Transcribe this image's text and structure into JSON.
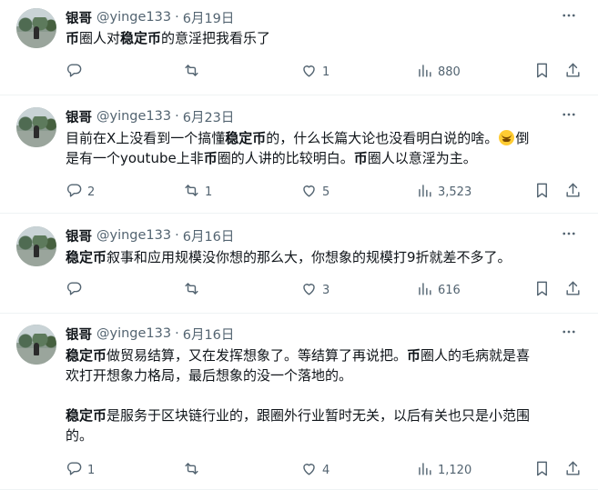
{
  "author": {
    "name": "银哥",
    "handle": "@yinge133",
    "separator": "·"
  },
  "tweets": [
    {
      "date": "6月19日",
      "lines": [
        [
          {
            "t": "币",
            "b": true
          },
          {
            "t": "圈人对",
            "b": false
          },
          {
            "t": "稳定币",
            "b": true
          },
          {
            "t": "的意淫把我看乐了",
            "b": false
          }
        ]
      ],
      "stats": {
        "replies": "",
        "retweets": "",
        "likes": "1",
        "views": "880"
      }
    },
    {
      "date": "6月23日",
      "lines": [
        [
          {
            "t": "目前在X上没看到一个搞懂",
            "b": false
          },
          {
            "t": "稳定币",
            "b": true
          },
          {
            "t": "的，什么长篇大论也没看明白说的啥。",
            "b": false
          },
          {
            "emoji": "grinning-sweat-emoji"
          },
          {
            "t": "倒",
            "b": false
          }
        ],
        [
          {
            "t": "是有一个youtube上非",
            "b": false
          },
          {
            "t": "币",
            "b": true
          },
          {
            "t": "圈的人讲的比较明白。",
            "b": false
          },
          {
            "t": "币",
            "b": true
          },
          {
            "t": "圈人以意淫为主。",
            "b": false
          }
        ]
      ],
      "stats": {
        "replies": "2",
        "retweets": "1",
        "likes": "5",
        "views": "3,523"
      }
    },
    {
      "date": "6月16日",
      "lines": [
        [
          {
            "t": "稳定币",
            "b": true
          },
          {
            "t": "叙事和应用规模没你想的那么大，你想象的规模打9折就差不多了。",
            "b": false
          }
        ]
      ],
      "stats": {
        "replies": "",
        "retweets": "",
        "likes": "3",
        "views": "616"
      }
    },
    {
      "date": "6月16日",
      "lines": [
        [
          {
            "t": "稳定币",
            "b": true
          },
          {
            "t": "做贸易结算，又在发挥想象了。等结算了再说把。",
            "b": false
          },
          {
            "t": "币",
            "b": true
          },
          {
            "t": "圈人的毛病就是喜",
            "b": false
          }
        ],
        [
          {
            "t": "欢打开想象力格局，最后想象的没一个落地的。",
            "b": false
          }
        ],
        [],
        [
          {
            "t": "稳定币",
            "b": true
          },
          {
            "t": "是服务于区块链行业的，跟圈外行业暂时无关，以后有关也只是小范围",
            "b": false
          }
        ],
        [
          {
            "t": "的。",
            "b": false
          }
        ]
      ],
      "stats": {
        "replies": "1",
        "retweets": "",
        "likes": "4",
        "views": "1,120"
      }
    }
  ]
}
